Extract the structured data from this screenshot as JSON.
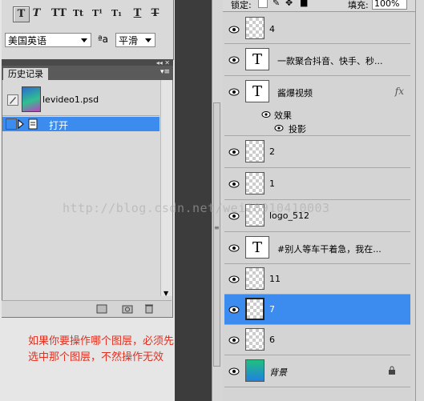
{
  "char_panel": {
    "style_buttons": [
      "T",
      "T",
      "TT",
      "Tt",
      "T¹",
      "T₁",
      "T",
      "T"
    ],
    "language": "美国英语",
    "aa_label": "ªa",
    "antialias": "平滑"
  },
  "history": {
    "tab_label": "历史记录",
    "snapshot_name": "levideo1.psd",
    "steps": [
      "打开"
    ]
  },
  "note": {
    "line1": "如果你要操作哪个图层，必须先",
    "line2": "选中那个图层，不然操作无效"
  },
  "layers_panel": {
    "lock_label": "锁定:",
    "fill_label": "填充:",
    "fill_value": "100%",
    "layers": [
      {
        "name": "4",
        "thumb": "checker"
      },
      {
        "name": "一款聚合抖音、快手、秒...",
        "thumb": "text"
      },
      {
        "name": "酱爆视频",
        "thumb": "text",
        "fx": "fx"
      },
      {
        "name": "效果",
        "thumb": "effects"
      },
      {
        "name": "投影",
        "thumb": "effect"
      },
      {
        "name": "2",
        "thumb": "checker"
      },
      {
        "name": "1",
        "thumb": "checker"
      },
      {
        "name": "logo_512",
        "thumb": "checker"
      },
      {
        "name": "#别人等车干着急，我在...",
        "thumb": "text"
      },
      {
        "name": "11",
        "thumb": "checker"
      },
      {
        "name": "7",
        "thumb": "checker",
        "selected": true
      },
      {
        "name": "6",
        "thumb": "checker"
      },
      {
        "name": "背景",
        "thumb": "background",
        "locked": true
      }
    ]
  },
  "watermark": "http://blog.csdn.net/wei10910410003",
  "colors": {
    "selection": "#3c8cf0",
    "note_text": "#e03020"
  }
}
